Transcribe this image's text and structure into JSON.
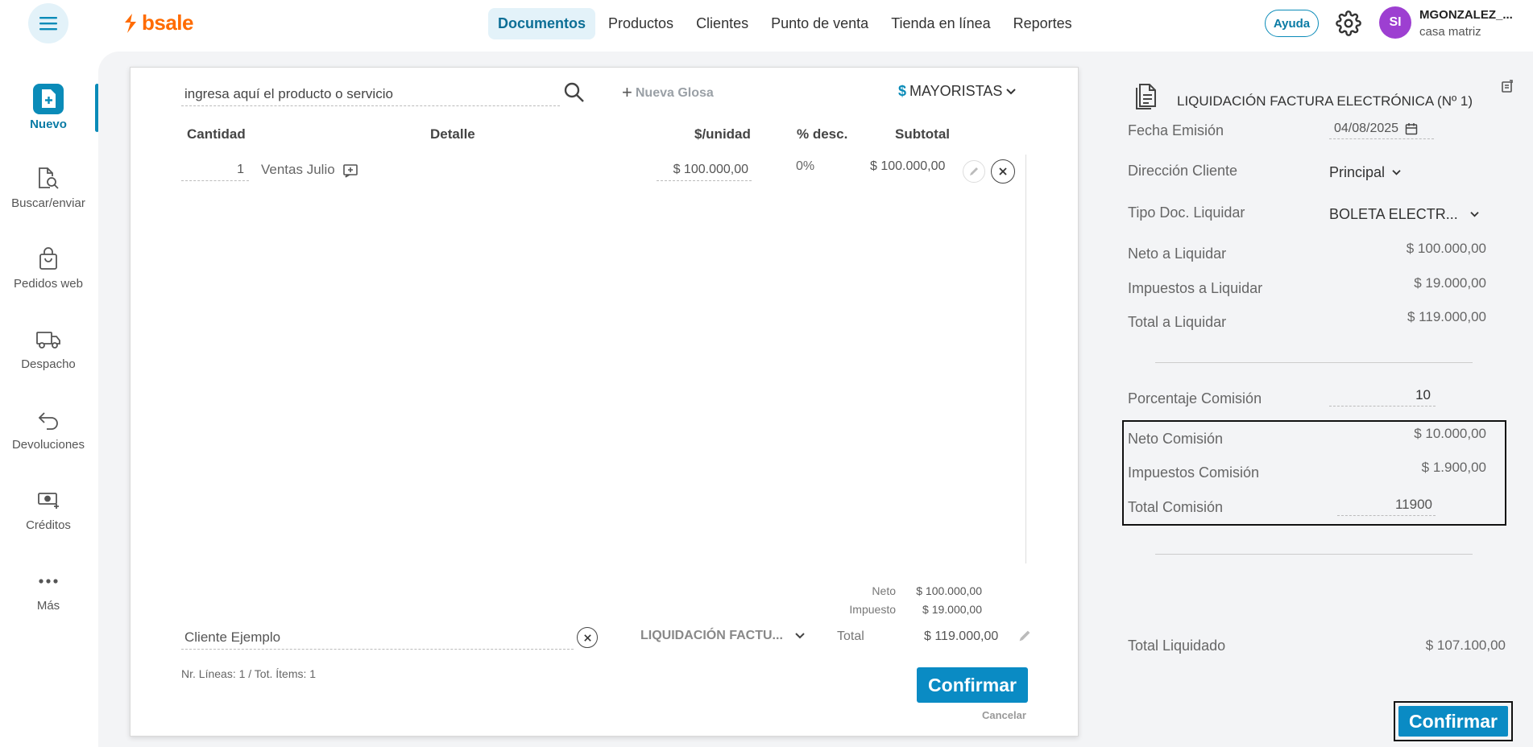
{
  "brand": {
    "name": "bsale",
    "color": "#ff6b00"
  },
  "accent": "#0a8bc4",
  "topnav": {
    "items": [
      "Documentos",
      "Productos",
      "Clientes",
      "Punto de venta",
      "Tienda en línea",
      "Reportes"
    ],
    "active": "Documentos"
  },
  "header": {
    "help_label": "Ayuda",
    "avatar_initials": "SI",
    "user_name": "MGONZALEZ_...",
    "user_branch": "casa matriz"
  },
  "sidebar": {
    "items": [
      {
        "label": "Nuevo",
        "icon": "new-document-icon",
        "active": true
      },
      {
        "label": "Buscar/enviar",
        "icon": "search-document-icon"
      },
      {
        "label": "Pedidos web",
        "icon": "shopping-bag-icon"
      },
      {
        "label": "Despacho",
        "icon": "truck-icon"
      },
      {
        "label": "Devoluciones",
        "icon": "return-arrow-icon"
      },
      {
        "label": "Créditos",
        "icon": "money-icon"
      },
      {
        "label": "Más",
        "icon": "more-dots-icon"
      }
    ]
  },
  "document": {
    "search_placeholder": "ingresa aquí el producto o servicio",
    "new_gloss_label": "Nueva Glosa",
    "price_list_currency": "$",
    "price_list": "MAYORISTAS",
    "columns": {
      "qty": "Cantidad",
      "detail": "Detalle",
      "unit_price": "$/unidad",
      "discount": "% desc.",
      "subtotal": "Subtotal"
    },
    "line": {
      "qty": "1",
      "detail": "Ventas Julio",
      "unit_price": "$ 100.000,00",
      "discount": "0%",
      "subtotal": "$ 100.000,00"
    },
    "totals": {
      "net_label": "Neto",
      "net_value": "$ 100.000,00",
      "tax_label": "Impuesto",
      "tax_value": "$ 19.000,00",
      "total_label": "Total",
      "total_value": "$ 119.000,00"
    },
    "client": "Cliente Ejemplo",
    "doc_type": "LIQUIDACIÓN FACTU...",
    "lines_info": "Nr. Líneas: 1 / Tot. Ítems: 1",
    "confirm_label": "Confirmar",
    "cancel_label": "Cancelar"
  },
  "liquidation": {
    "title": "LIQUIDACIÓN FACTURA ELECTRÓNICA (Nº 1)",
    "emission_label": "Fecha Emisión",
    "emission_date": "04/08/2025",
    "address_label": "Dirección Cliente",
    "address_value": "Principal",
    "doc_type_label": "Tipo Doc. Liquidar",
    "doc_type_value": "BOLETA ELECTR...",
    "net_label": "Neto a Liquidar",
    "net_value": "$ 100.000,00",
    "tax_label": "Impuestos a Liquidar",
    "tax_value": "$ 19.000,00",
    "total_label": "Total a Liquidar",
    "total_value": "$ 119.000,00",
    "commission_pct_label": "Porcentaje Comisión",
    "commission_pct_value": "10",
    "commission_net_label": "Neto Comisión",
    "commission_net_value": "$ 10.000,00",
    "commission_tax_label": "Impuestos Comisión",
    "commission_tax_value": "$ 1.900,00",
    "commission_total_label": "Total Comisión",
    "commission_total_value": "11900",
    "liquidated_label": "Total Liquidado",
    "liquidated_value": "$ 107.100,00",
    "confirm_label": "Confirmar"
  }
}
